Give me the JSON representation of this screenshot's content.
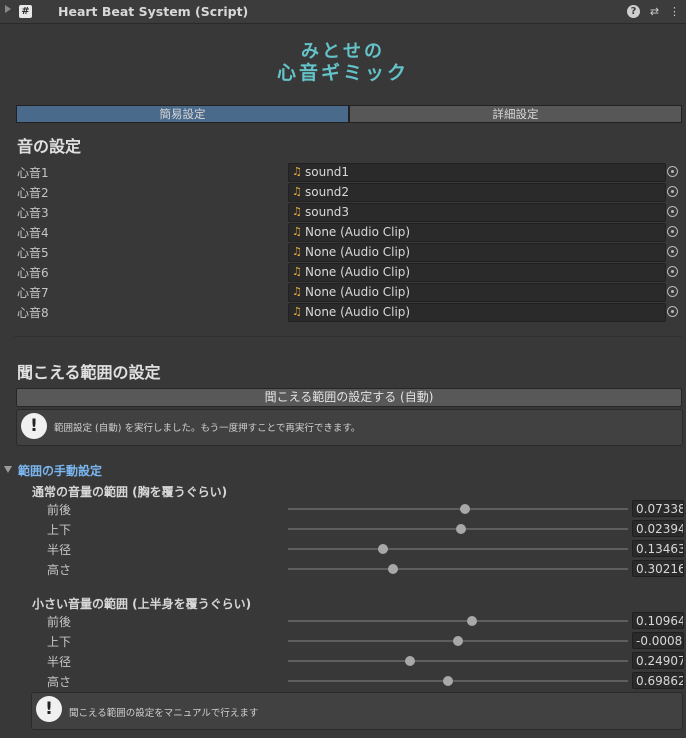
{
  "header": {
    "title": "Heart Beat System (Script)",
    "script_glyph": "#",
    "help_glyph": "?",
    "presets_glyph": "⇄",
    "more_glyph": "⋮"
  },
  "logo": {
    "line1": "みとせの",
    "line2": "心音ギミック",
    "color": "#63c3c8"
  },
  "tabs": [
    {
      "label": "簡易設定",
      "active": true
    },
    {
      "label": "詳細設定",
      "active": false
    }
  ],
  "sound_section": {
    "title": "音の設定",
    "rows": [
      {
        "label": "心音1",
        "value": "sound1"
      },
      {
        "label": "心音2",
        "value": "sound2"
      },
      {
        "label": "心音3",
        "value": "sound3"
      },
      {
        "label": "心音4",
        "value": "None (Audio Clip)"
      },
      {
        "label": "心音5",
        "value": "None (Audio Clip)"
      },
      {
        "label": "心音6",
        "value": "None (Audio Clip)"
      },
      {
        "label": "心音7",
        "value": "None (Audio Clip)"
      },
      {
        "label": "心音8",
        "value": "None (Audio Clip)"
      }
    ]
  },
  "range_section": {
    "title": "聞こえる範囲の設定",
    "auto_button": "聞こえる範囲の設定する (自動)",
    "auto_message": "範囲設定 (自動) を実行しました。もう一度押すことで再実行できます。",
    "manual_foldout": "範囲の手動設定",
    "normal_group": {
      "title": "通常の音量の範囲 (胸を覆うぐらい)",
      "sliders": [
        {
          "label": "前後",
          "value": "0.07338",
          "fraction": 0.52
        },
        {
          "label": "上下",
          "value": "0.02394",
          "fraction": 0.51
        },
        {
          "label": "半径",
          "value": "0.13463",
          "fraction": 0.28
        },
        {
          "label": "高さ",
          "value": "0.30216",
          "fraction": 0.31
        }
      ]
    },
    "small_group": {
      "title": "小さい音量の範囲 (上半身を覆うぐらい)",
      "sliders": [
        {
          "label": "前後",
          "value": "0.10964",
          "fraction": 0.54
        },
        {
          "label": "上下",
          "value": "-0.0008",
          "fraction": 0.5
        },
        {
          "label": "半径",
          "value": "0.24907",
          "fraction": 0.36
        },
        {
          "label": "高さ",
          "value": "0.69862",
          "fraction": 0.47
        }
      ]
    },
    "manual_message": "聞こえる範囲の設定をマニュアルで行えます"
  },
  "icons": {
    "note": "♫",
    "info": "!"
  }
}
